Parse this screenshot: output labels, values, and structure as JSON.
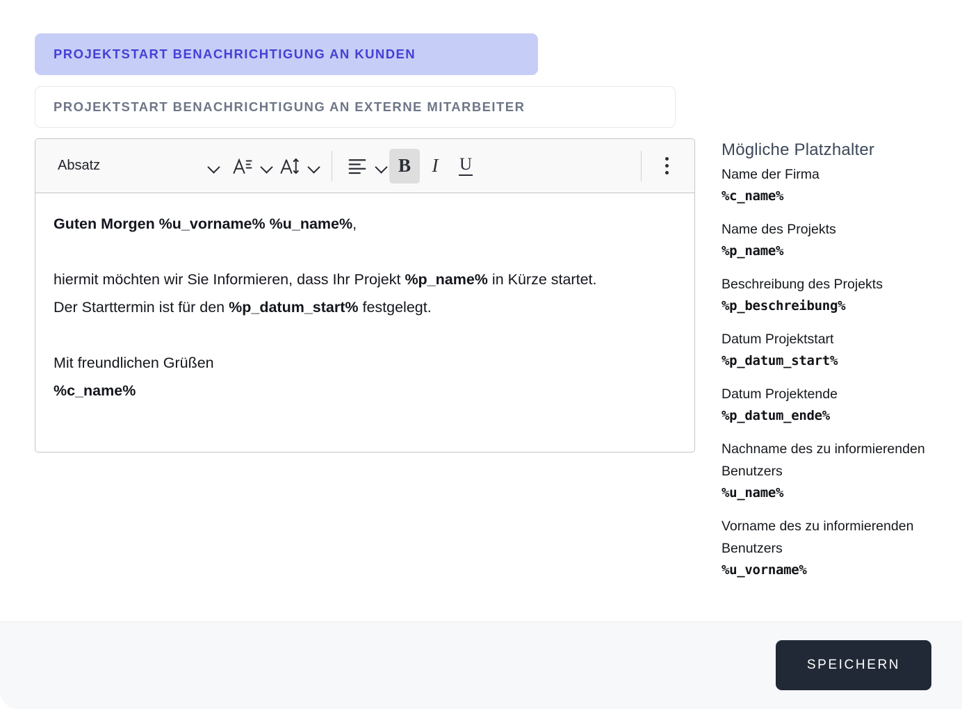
{
  "tabs": [
    {
      "label": "Projektstart Benachrichtigung an Kunden",
      "active": true
    },
    {
      "label": "Projektstart Benachrichtigung an externe Mitarbeiter",
      "active": false
    }
  ],
  "toolbar": {
    "block_format": "Absatz",
    "font_family_icon": "font-family-icon",
    "font_size_icon": "font-size-icon",
    "align_icon": "align-left-icon",
    "bold_label": "B",
    "italic_label": "I",
    "underline_label": "U",
    "bold_active": true,
    "overflow_icon": "kebab-menu-icon"
  },
  "editor": {
    "paragraphs": [
      [
        {
          "text": "Guten Morgen %u_vorname% %u_name%",
          "bold": true
        },
        {
          "text": ",",
          "bold": false
        }
      ],
      [
        {
          "text": "hiermit möchten wir Sie Informieren, dass Ihr Projekt ",
          "bold": false
        },
        {
          "text": "%p_name%",
          "bold": true
        },
        {
          "text": " in Kürze startet.",
          "bold": false
        },
        {
          "break": true
        },
        {
          "text": "Der Starttermin ist für den ",
          "bold": false
        },
        {
          "text": "%p_datum_start%",
          "bold": true
        },
        {
          "text": " festgelegt.",
          "bold": false
        }
      ],
      [
        {
          "text": "Mit freundlichen Grüßen",
          "bold": false
        },
        {
          "break": true
        },
        {
          "text": "%c_name%",
          "bold": true
        }
      ]
    ]
  },
  "panel": {
    "title": "Mögliche Platzhalter",
    "items": [
      {
        "label": "Name der Firma",
        "code": "%c_name%"
      },
      {
        "label": "Name des Projekts",
        "code": "%p_name%"
      },
      {
        "label": "Beschreibung des Projekts",
        "code": "%p_beschreibung%"
      },
      {
        "label": "Datum Projektstart",
        "code": "%p_datum_start%"
      },
      {
        "label": "Datum Projektende",
        "code": "%p_datum_ende%"
      },
      {
        "label": "Nachname des zu informierenden Benutzers",
        "code": "%u_name%"
      },
      {
        "label": "Vorname des zu informierenden Benutzers",
        "code": "%u_vorname%"
      }
    ]
  },
  "footer": {
    "save_label": "Speichern"
  },
  "colors": {
    "accent": "#4540d6",
    "tab_active_bg": "#c6cdf6",
    "tab_inactive_text": "#6e7687",
    "panel_title": "#3c4859",
    "save_button_bg": "#212936",
    "footer_bg": "#f7f8fa",
    "toolbar_bg": "#f9f9fa",
    "editor_border": "#c4c4c4"
  }
}
